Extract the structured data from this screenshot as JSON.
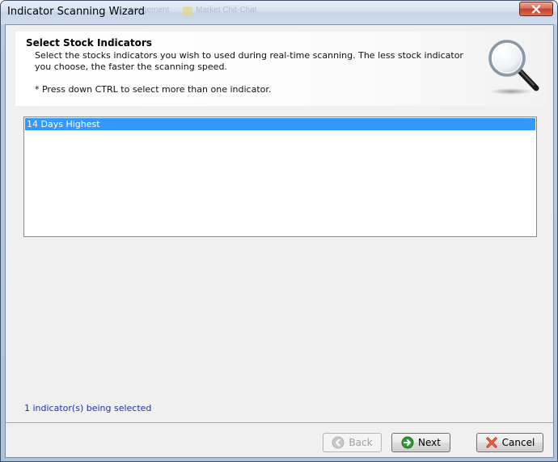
{
  "window": {
    "title": "Indicator Scanning Wizard",
    "background_tabs": [
      "...anagement",
      "Market Chit-Chat"
    ]
  },
  "header": {
    "title": "Select Stock Indicators",
    "description": "Select the stocks indicators you wish to used during real-time scanning. The less stock indicator you choose, the faster the scanning speed.",
    "note": "* Press down CTRL to select more than one indicator.",
    "icon": "magnifier-icon"
  },
  "indicator_list": {
    "items": [
      {
        "label": "14 Days Highest",
        "selected": true
      }
    ]
  },
  "status": {
    "text": "1 indicator(s) being selected"
  },
  "buttons": {
    "back": {
      "label": "Back",
      "enabled": false,
      "icon": "back-arrow-icon"
    },
    "next": {
      "label": "Next",
      "enabled": true,
      "icon": "next-arrow-icon"
    },
    "cancel": {
      "label": "Cancel",
      "enabled": true,
      "icon": "cancel-x-icon"
    }
  },
  "colors": {
    "selection": "#3399ff",
    "status_text": "#1a33b0",
    "next_icon": "#2e9b2e",
    "cancel_icon": "#d23a1e",
    "close_button": "#c2412a"
  }
}
